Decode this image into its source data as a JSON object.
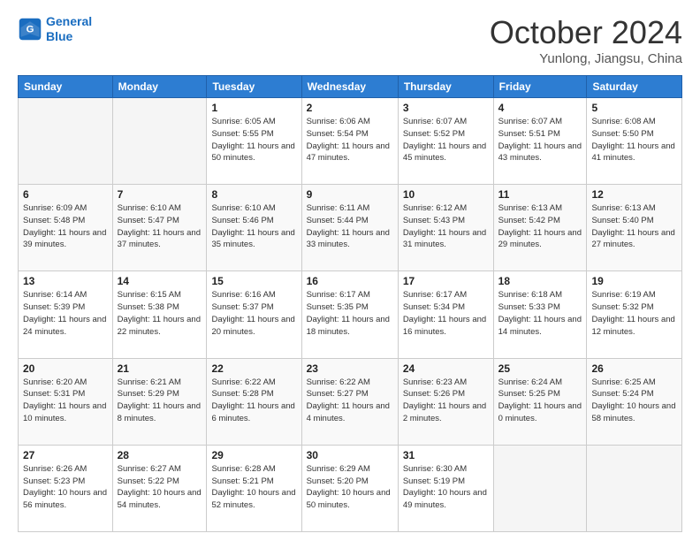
{
  "header": {
    "logo_line1": "General",
    "logo_line2": "Blue",
    "month": "October 2024",
    "location": "Yunlong, Jiangsu, China"
  },
  "weekdays": [
    "Sunday",
    "Monday",
    "Tuesday",
    "Wednesday",
    "Thursday",
    "Friday",
    "Saturday"
  ],
  "weeks": [
    [
      {
        "day": "",
        "sunrise": "",
        "sunset": "",
        "daylight": ""
      },
      {
        "day": "",
        "sunrise": "",
        "sunset": "",
        "daylight": ""
      },
      {
        "day": "1",
        "sunrise": "Sunrise: 6:05 AM",
        "sunset": "Sunset: 5:55 PM",
        "daylight": "Daylight: 11 hours and 50 minutes."
      },
      {
        "day": "2",
        "sunrise": "Sunrise: 6:06 AM",
        "sunset": "Sunset: 5:54 PM",
        "daylight": "Daylight: 11 hours and 47 minutes."
      },
      {
        "day": "3",
        "sunrise": "Sunrise: 6:07 AM",
        "sunset": "Sunset: 5:52 PM",
        "daylight": "Daylight: 11 hours and 45 minutes."
      },
      {
        "day": "4",
        "sunrise": "Sunrise: 6:07 AM",
        "sunset": "Sunset: 5:51 PM",
        "daylight": "Daylight: 11 hours and 43 minutes."
      },
      {
        "day": "5",
        "sunrise": "Sunrise: 6:08 AM",
        "sunset": "Sunset: 5:50 PM",
        "daylight": "Daylight: 11 hours and 41 minutes."
      }
    ],
    [
      {
        "day": "6",
        "sunrise": "Sunrise: 6:09 AM",
        "sunset": "Sunset: 5:48 PM",
        "daylight": "Daylight: 11 hours and 39 minutes."
      },
      {
        "day": "7",
        "sunrise": "Sunrise: 6:10 AM",
        "sunset": "Sunset: 5:47 PM",
        "daylight": "Daylight: 11 hours and 37 minutes."
      },
      {
        "day": "8",
        "sunrise": "Sunrise: 6:10 AM",
        "sunset": "Sunset: 5:46 PM",
        "daylight": "Daylight: 11 hours and 35 minutes."
      },
      {
        "day": "9",
        "sunrise": "Sunrise: 6:11 AM",
        "sunset": "Sunset: 5:44 PM",
        "daylight": "Daylight: 11 hours and 33 minutes."
      },
      {
        "day": "10",
        "sunrise": "Sunrise: 6:12 AM",
        "sunset": "Sunset: 5:43 PM",
        "daylight": "Daylight: 11 hours and 31 minutes."
      },
      {
        "day": "11",
        "sunrise": "Sunrise: 6:13 AM",
        "sunset": "Sunset: 5:42 PM",
        "daylight": "Daylight: 11 hours and 29 minutes."
      },
      {
        "day": "12",
        "sunrise": "Sunrise: 6:13 AM",
        "sunset": "Sunset: 5:40 PM",
        "daylight": "Daylight: 11 hours and 27 minutes."
      }
    ],
    [
      {
        "day": "13",
        "sunrise": "Sunrise: 6:14 AM",
        "sunset": "Sunset: 5:39 PM",
        "daylight": "Daylight: 11 hours and 24 minutes."
      },
      {
        "day": "14",
        "sunrise": "Sunrise: 6:15 AM",
        "sunset": "Sunset: 5:38 PM",
        "daylight": "Daylight: 11 hours and 22 minutes."
      },
      {
        "day": "15",
        "sunrise": "Sunrise: 6:16 AM",
        "sunset": "Sunset: 5:37 PM",
        "daylight": "Daylight: 11 hours and 20 minutes."
      },
      {
        "day": "16",
        "sunrise": "Sunrise: 6:17 AM",
        "sunset": "Sunset: 5:35 PM",
        "daylight": "Daylight: 11 hours and 18 minutes."
      },
      {
        "day": "17",
        "sunrise": "Sunrise: 6:17 AM",
        "sunset": "Sunset: 5:34 PM",
        "daylight": "Daylight: 11 hours and 16 minutes."
      },
      {
        "day": "18",
        "sunrise": "Sunrise: 6:18 AM",
        "sunset": "Sunset: 5:33 PM",
        "daylight": "Daylight: 11 hours and 14 minutes."
      },
      {
        "day": "19",
        "sunrise": "Sunrise: 6:19 AM",
        "sunset": "Sunset: 5:32 PM",
        "daylight": "Daylight: 11 hours and 12 minutes."
      }
    ],
    [
      {
        "day": "20",
        "sunrise": "Sunrise: 6:20 AM",
        "sunset": "Sunset: 5:31 PM",
        "daylight": "Daylight: 11 hours and 10 minutes."
      },
      {
        "day": "21",
        "sunrise": "Sunrise: 6:21 AM",
        "sunset": "Sunset: 5:29 PM",
        "daylight": "Daylight: 11 hours and 8 minutes."
      },
      {
        "day": "22",
        "sunrise": "Sunrise: 6:22 AM",
        "sunset": "Sunset: 5:28 PM",
        "daylight": "Daylight: 11 hours and 6 minutes."
      },
      {
        "day": "23",
        "sunrise": "Sunrise: 6:22 AM",
        "sunset": "Sunset: 5:27 PM",
        "daylight": "Daylight: 11 hours and 4 minutes."
      },
      {
        "day": "24",
        "sunrise": "Sunrise: 6:23 AM",
        "sunset": "Sunset: 5:26 PM",
        "daylight": "Daylight: 11 hours and 2 minutes."
      },
      {
        "day": "25",
        "sunrise": "Sunrise: 6:24 AM",
        "sunset": "Sunset: 5:25 PM",
        "daylight": "Daylight: 11 hours and 0 minutes."
      },
      {
        "day": "26",
        "sunrise": "Sunrise: 6:25 AM",
        "sunset": "Sunset: 5:24 PM",
        "daylight": "Daylight: 10 hours and 58 minutes."
      }
    ],
    [
      {
        "day": "27",
        "sunrise": "Sunrise: 6:26 AM",
        "sunset": "Sunset: 5:23 PM",
        "daylight": "Daylight: 10 hours and 56 minutes."
      },
      {
        "day": "28",
        "sunrise": "Sunrise: 6:27 AM",
        "sunset": "Sunset: 5:22 PM",
        "daylight": "Daylight: 10 hours and 54 minutes."
      },
      {
        "day": "29",
        "sunrise": "Sunrise: 6:28 AM",
        "sunset": "Sunset: 5:21 PM",
        "daylight": "Daylight: 10 hours and 52 minutes."
      },
      {
        "day": "30",
        "sunrise": "Sunrise: 6:29 AM",
        "sunset": "Sunset: 5:20 PM",
        "daylight": "Daylight: 10 hours and 50 minutes."
      },
      {
        "day": "31",
        "sunrise": "Sunrise: 6:30 AM",
        "sunset": "Sunset: 5:19 PM",
        "daylight": "Daylight: 10 hours and 49 minutes."
      },
      {
        "day": "",
        "sunrise": "",
        "sunset": "",
        "daylight": ""
      },
      {
        "day": "",
        "sunrise": "",
        "sunset": "",
        "daylight": ""
      }
    ]
  ]
}
